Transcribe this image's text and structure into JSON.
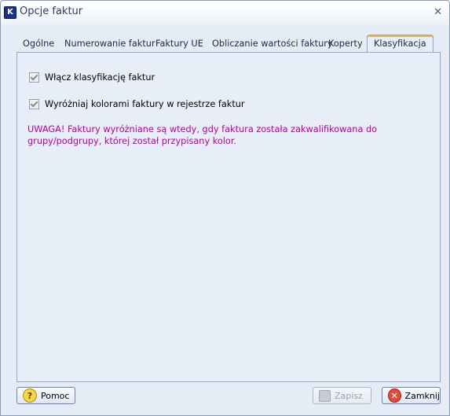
{
  "window": {
    "title": "Opcje faktur",
    "app_icon_letter": "K"
  },
  "tabs": [
    {
      "label": "Ogólne"
    },
    {
      "label": "Numerowanie faktur"
    },
    {
      "label": "Faktury UE"
    },
    {
      "label": "Obliczanie wartości faktury"
    },
    {
      "label": "Koperty"
    },
    {
      "label": "Klasyfikacja",
      "active": true
    }
  ],
  "content": {
    "checkbox1": {
      "label": "Włącz klasyfikację faktur",
      "checked": true
    },
    "checkbox2": {
      "label": "Wyróżniaj kolorami faktury w rejestrze faktur",
      "checked": true
    },
    "warning": "UWAGA! Faktury wyróżniane są wtedy, gdy faktura została zakwalifikowana do grupy/podgrupy, której został przypisany kolor.",
    "warning_color": "#b5009b"
  },
  "buttons": {
    "help": "Pomoc",
    "save": "Zapisz",
    "close": "Zamknij"
  }
}
